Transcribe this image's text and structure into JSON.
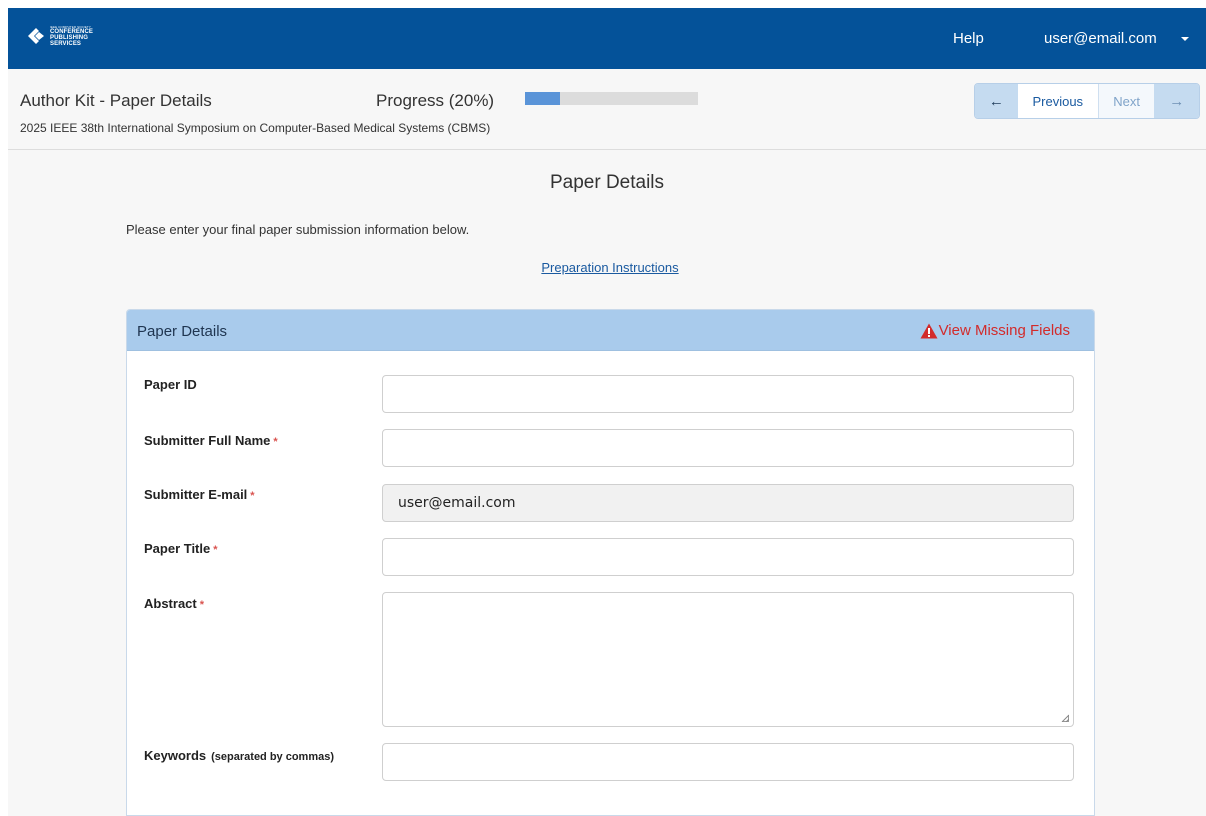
{
  "topbar": {
    "logo": {
      "line_small": "IEEE COMPUTER SOCIETY",
      "line1": "CONFERENCE",
      "line2": "PUBLISHING",
      "line3": "SERVICES"
    },
    "help_label": "Help",
    "user_label": "user@email.com",
    "brand_color": "#045299"
  },
  "subheader": {
    "kit_title": "Author Kit - Paper Details",
    "conference": "2025 IEEE 38th International Symposium on Computer-Based Medical Systems (CBMS)",
    "progress_label": "Progress (20%)",
    "progress_fraction": 0.2,
    "prev_label": "Previous",
    "next_label": "Next",
    "prev_arrow": "←",
    "next_arrow": "→"
  },
  "main": {
    "title": "Paper Details",
    "intro": "Please enter your final paper submission information below.",
    "prep_link": "Preparation Instructions"
  },
  "panel": {
    "title": "Paper Details",
    "missing_label": "View Missing Fields",
    "missing_color": "#d22b2b",
    "fields": [
      {
        "label": "Paper ID",
        "required": false,
        "value": ""
      },
      {
        "label": "Submitter Full Name",
        "required": true,
        "value": ""
      },
      {
        "label": "Submitter E-mail",
        "required": true,
        "value": "user@email.com"
      },
      {
        "label": "Paper Title",
        "required": true,
        "value": ""
      },
      {
        "label": "Abstract",
        "required": true,
        "value": ""
      },
      {
        "label": "Keywords",
        "note": "(separated by commas)",
        "required": false,
        "value": ""
      }
    ],
    "required_mark": "*"
  }
}
